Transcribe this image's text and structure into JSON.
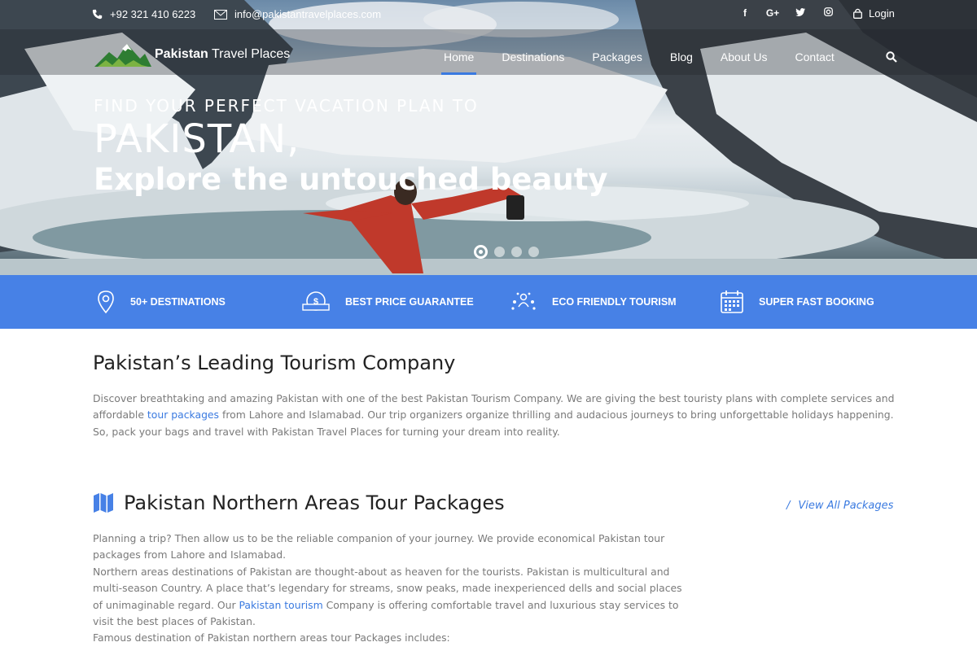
{
  "topbar": {
    "phone": "+92 321 410 6223",
    "email": "info@pakistantravelplaces.com",
    "socials": [
      "f",
      "G+",
      "twitter",
      "instagram"
    ],
    "login": "Login"
  },
  "logo": {
    "bold": "Pakistan",
    "rest": " Travel Places"
  },
  "nav": {
    "items": [
      "Home",
      "Destinations",
      "Packages",
      "Blog",
      "About Us",
      "Contact"
    ],
    "active": "Home"
  },
  "hero": {
    "kicker": "FIND YOUR PERFECT VACATION PLAN TO",
    "big": "PAKISTAN,",
    "sub": "Explore the untouched beauty",
    "slides": 4,
    "active_slide": 1
  },
  "features": [
    {
      "icon": "map-pin-icon",
      "label": "50+ DESTINATIONS"
    },
    {
      "icon": "price-badge-icon",
      "label": "BEST PRICE GUARANTEE"
    },
    {
      "icon": "people-icon",
      "label": "ECO FRIENDLY TOURISM"
    },
    {
      "icon": "calendar-icon",
      "label": "SUPER FAST BOOKING"
    }
  ],
  "colors": {
    "accent": "#4781e6",
    "link": "#3a7ae0",
    "text": "#7a7a7a"
  },
  "intro": {
    "title": "Pakistan’s Leading Tourism Company",
    "p_before": "Discover breathtaking and amazing Pakistan with one of the best Pakistan Tourism Company. We are giving the best touristy plans with complete services and affordable ",
    "p_link": "tour packages",
    "p_after": " from Lahore and Islamabad. Our trip organizers organize thrilling and audacious journeys to bring unforgettable holidays happening. So, pack your bags and travel with Pakistan Travel Places for turning your dream into reality."
  },
  "packages": {
    "title": "Pakistan Northern Areas Tour Packages",
    "view_all": "View All Packages",
    "line1": "Planning a trip? Then allow us to be the reliable companion of your journey. We provide economical Pakistan tour packages from Lahore and Islamabad.",
    "line2_before": "Northern areas destinations of Pakistan are thought-about as heaven for the tourists. Pakistan is multicultural and multi-season Country. A place that’s legendary for streams, snow peaks, made inexperienced dells and social places of unimaginable regard. Our ",
    "line2_link": "Pakistan tourism",
    "line2_after": " Company is offering comfortable travel and luxurious stay services to visit the best places of Pakistan.",
    "line3": "Famous destination of Pakistan northern areas tour Packages includes:"
  }
}
